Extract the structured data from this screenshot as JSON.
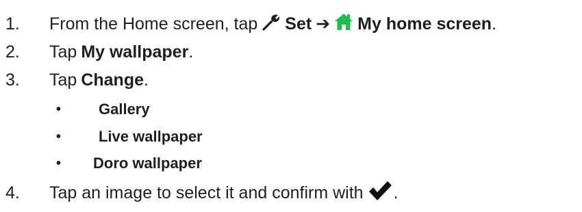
{
  "steps": [
    {
      "num": "1.",
      "text_before": "From the Home screen, tap",
      "set_label": "Set",
      "arrow": "➔",
      "home_label": "My home screen",
      "period": ".",
      "icons": {
        "settings": "wrench-icon",
        "home": "home-icon"
      },
      "colors": {
        "home_icon": "#1bbf4a"
      }
    },
    {
      "num": "2.",
      "text_before": "Tap",
      "bold": "My wallpaper",
      "period": "."
    },
    {
      "num": "3.",
      "text_before": "Tap",
      "bold": "Change",
      "period": "."
    },
    {
      "num": "4.",
      "text_before": "Tap an image to select it and confirm with",
      "period": ".",
      "icons": {
        "confirm": "checkmark-icon"
      }
    }
  ],
  "options": [
    {
      "bullet": "•",
      "label": "Gallery"
    },
    {
      "bullet": "•",
      "label": "Live wallpaper"
    },
    {
      "bullet": "•",
      "label": "Doro wallpaper"
    }
  ]
}
